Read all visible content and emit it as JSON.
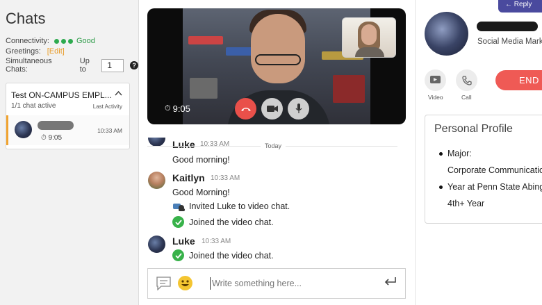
{
  "left": {
    "title": "Chats",
    "connectivity_label": "Connectivity:",
    "connectivity_status": "Good",
    "greetings_label": "Greetings:",
    "greetings_edit": "[Edit]",
    "simul_label": "Simultaneous Chats:",
    "simul_upto": "Up to",
    "simul_value": "1",
    "queue": {
      "title": "Test ON-CAMPUS EMPL...",
      "subtitle": "1/1 chat active",
      "sort_label": "Last Activity",
      "item": {
        "duration": "9:05",
        "timestamp": "10:33 AM"
      }
    }
  },
  "video": {
    "timer": "9:05"
  },
  "chat": {
    "date_divider": "Today",
    "messages": [
      {
        "name": "Luke",
        "time": "10:33 AM",
        "lines": [
          "Good morning!"
        ]
      },
      {
        "name": "Kaitlyn",
        "time": "10:33 AM",
        "lines": [
          "Good Morning!"
        ],
        "system": [
          "Invited Luke to video chat.",
          "Joined the video chat."
        ]
      },
      {
        "name": "Luke",
        "time": "10:33 AM",
        "system": [
          "Joined the video chat."
        ]
      }
    ],
    "composer_placeholder": "Write something here..."
  },
  "right": {
    "banner": "Reply",
    "role": "Social Media Mark",
    "video_label": "Video",
    "call_label": "Call",
    "end_label": "END C",
    "profile": {
      "title": "Personal Profile",
      "major_label": "Major:",
      "major_value": "Corporate Communication",
      "year_label": "Year at Penn State Abingto",
      "year_value": "4th+ Year"
    }
  },
  "colors": {
    "accent_orange": "#f0a330",
    "end_red": "#e9504a",
    "success_green": "#38b24a",
    "banner_purple": "#4a4a9e"
  }
}
